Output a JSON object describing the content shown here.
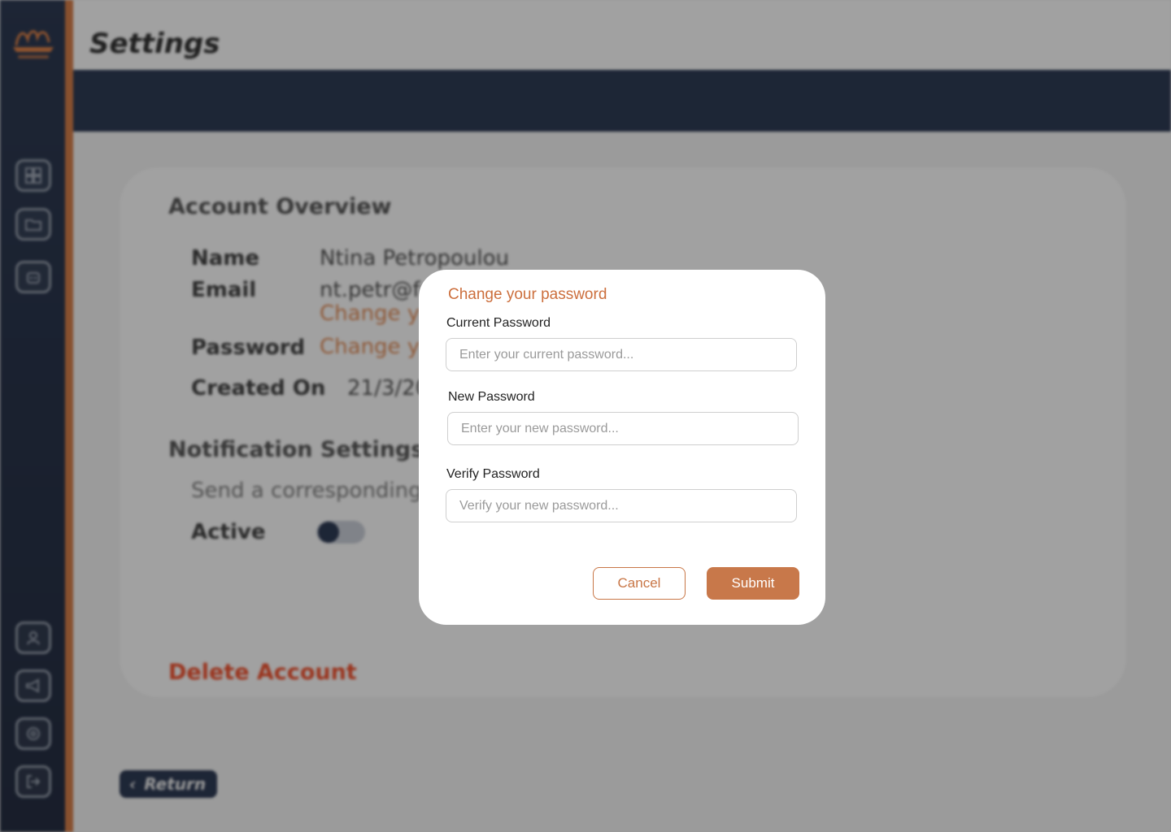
{
  "header": {
    "title": "Settings"
  },
  "sidebar": {
    "top_icons": [
      "dashboard-icon",
      "folder-icon",
      "robot-icon"
    ],
    "bottom_icons": [
      "profile-icon",
      "megaphone-icon",
      "settings-icon",
      "logout-icon"
    ]
  },
  "account": {
    "section_title": "Account Overview",
    "name_label": "Name",
    "name_value": "Ntina Petropoulou",
    "email_label": "Email",
    "email_value": "nt.petr@f",
    "email_change": "Change y",
    "password_label": "Password",
    "password_change": "Change y",
    "created_label": "Created On",
    "created_value": "21/3/20"
  },
  "notifications": {
    "section_title": "Notification Settings",
    "description": "Send a corresponding",
    "active_label": "Active",
    "active": true
  },
  "delete_account": "Delete Account",
  "return_label": "Return",
  "modal": {
    "title": "Change your password",
    "current_label": "Current Password",
    "current_placeholder": "Enter your current password...",
    "new_label": "New Password",
    "new_placeholder": "Enter your new password...",
    "verify_label": "Verify Password",
    "verify_placeholder": "Verify your new password...",
    "cancel_label": "Cancel",
    "submit_label": "Submit"
  },
  "colors": {
    "accent": "#c8784a",
    "navy": "#1d2b47",
    "danger": "#f2451f"
  }
}
